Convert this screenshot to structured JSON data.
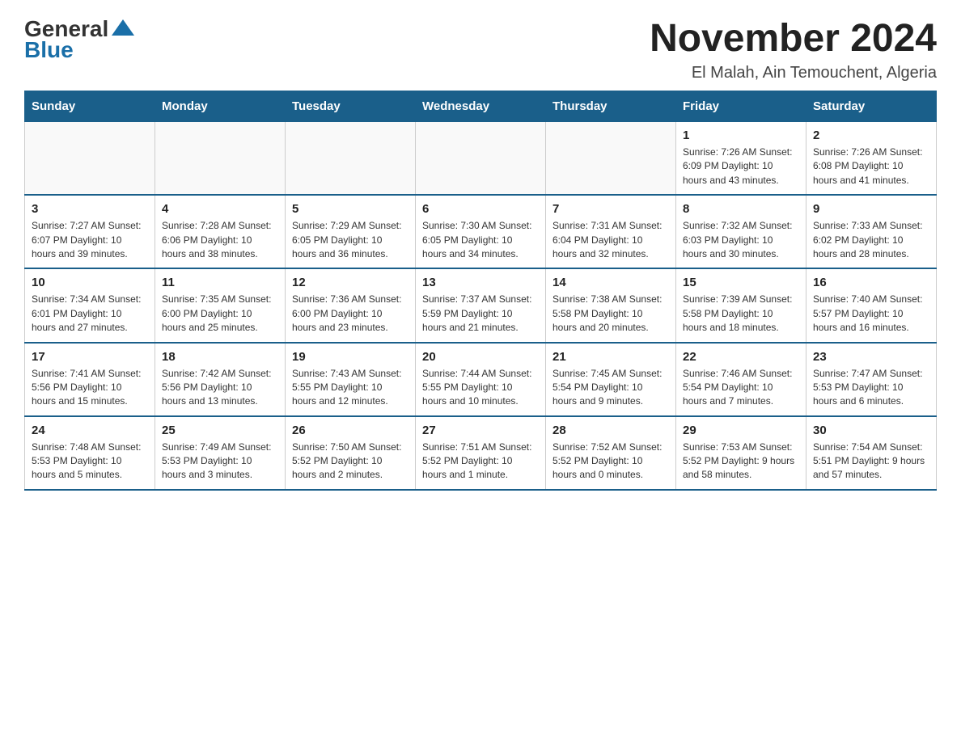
{
  "header": {
    "logo_general": "General",
    "logo_blue": "Blue",
    "title": "November 2024",
    "location": "El Malah, Ain Temouchent, Algeria"
  },
  "days_of_week": [
    "Sunday",
    "Monday",
    "Tuesday",
    "Wednesday",
    "Thursday",
    "Friday",
    "Saturday"
  ],
  "weeks": [
    [
      {
        "day": "",
        "info": ""
      },
      {
        "day": "",
        "info": ""
      },
      {
        "day": "",
        "info": ""
      },
      {
        "day": "",
        "info": ""
      },
      {
        "day": "",
        "info": ""
      },
      {
        "day": "1",
        "info": "Sunrise: 7:26 AM\nSunset: 6:09 PM\nDaylight: 10 hours and 43 minutes."
      },
      {
        "day": "2",
        "info": "Sunrise: 7:26 AM\nSunset: 6:08 PM\nDaylight: 10 hours and 41 minutes."
      }
    ],
    [
      {
        "day": "3",
        "info": "Sunrise: 7:27 AM\nSunset: 6:07 PM\nDaylight: 10 hours and 39 minutes."
      },
      {
        "day": "4",
        "info": "Sunrise: 7:28 AM\nSunset: 6:06 PM\nDaylight: 10 hours and 38 minutes."
      },
      {
        "day": "5",
        "info": "Sunrise: 7:29 AM\nSunset: 6:05 PM\nDaylight: 10 hours and 36 minutes."
      },
      {
        "day": "6",
        "info": "Sunrise: 7:30 AM\nSunset: 6:05 PM\nDaylight: 10 hours and 34 minutes."
      },
      {
        "day": "7",
        "info": "Sunrise: 7:31 AM\nSunset: 6:04 PM\nDaylight: 10 hours and 32 minutes."
      },
      {
        "day": "8",
        "info": "Sunrise: 7:32 AM\nSunset: 6:03 PM\nDaylight: 10 hours and 30 minutes."
      },
      {
        "day": "9",
        "info": "Sunrise: 7:33 AM\nSunset: 6:02 PM\nDaylight: 10 hours and 28 minutes."
      }
    ],
    [
      {
        "day": "10",
        "info": "Sunrise: 7:34 AM\nSunset: 6:01 PM\nDaylight: 10 hours and 27 minutes."
      },
      {
        "day": "11",
        "info": "Sunrise: 7:35 AM\nSunset: 6:00 PM\nDaylight: 10 hours and 25 minutes."
      },
      {
        "day": "12",
        "info": "Sunrise: 7:36 AM\nSunset: 6:00 PM\nDaylight: 10 hours and 23 minutes."
      },
      {
        "day": "13",
        "info": "Sunrise: 7:37 AM\nSunset: 5:59 PM\nDaylight: 10 hours and 21 minutes."
      },
      {
        "day": "14",
        "info": "Sunrise: 7:38 AM\nSunset: 5:58 PM\nDaylight: 10 hours and 20 minutes."
      },
      {
        "day": "15",
        "info": "Sunrise: 7:39 AM\nSunset: 5:58 PM\nDaylight: 10 hours and 18 minutes."
      },
      {
        "day": "16",
        "info": "Sunrise: 7:40 AM\nSunset: 5:57 PM\nDaylight: 10 hours and 16 minutes."
      }
    ],
    [
      {
        "day": "17",
        "info": "Sunrise: 7:41 AM\nSunset: 5:56 PM\nDaylight: 10 hours and 15 minutes."
      },
      {
        "day": "18",
        "info": "Sunrise: 7:42 AM\nSunset: 5:56 PM\nDaylight: 10 hours and 13 minutes."
      },
      {
        "day": "19",
        "info": "Sunrise: 7:43 AM\nSunset: 5:55 PM\nDaylight: 10 hours and 12 minutes."
      },
      {
        "day": "20",
        "info": "Sunrise: 7:44 AM\nSunset: 5:55 PM\nDaylight: 10 hours and 10 minutes."
      },
      {
        "day": "21",
        "info": "Sunrise: 7:45 AM\nSunset: 5:54 PM\nDaylight: 10 hours and 9 minutes."
      },
      {
        "day": "22",
        "info": "Sunrise: 7:46 AM\nSunset: 5:54 PM\nDaylight: 10 hours and 7 minutes."
      },
      {
        "day": "23",
        "info": "Sunrise: 7:47 AM\nSunset: 5:53 PM\nDaylight: 10 hours and 6 minutes."
      }
    ],
    [
      {
        "day": "24",
        "info": "Sunrise: 7:48 AM\nSunset: 5:53 PM\nDaylight: 10 hours and 5 minutes."
      },
      {
        "day": "25",
        "info": "Sunrise: 7:49 AM\nSunset: 5:53 PM\nDaylight: 10 hours and 3 minutes."
      },
      {
        "day": "26",
        "info": "Sunrise: 7:50 AM\nSunset: 5:52 PM\nDaylight: 10 hours and 2 minutes."
      },
      {
        "day": "27",
        "info": "Sunrise: 7:51 AM\nSunset: 5:52 PM\nDaylight: 10 hours and 1 minute."
      },
      {
        "day": "28",
        "info": "Sunrise: 7:52 AM\nSunset: 5:52 PM\nDaylight: 10 hours and 0 minutes."
      },
      {
        "day": "29",
        "info": "Sunrise: 7:53 AM\nSunset: 5:52 PM\nDaylight: 9 hours and 58 minutes."
      },
      {
        "day": "30",
        "info": "Sunrise: 7:54 AM\nSunset: 5:51 PM\nDaylight: 9 hours and 57 minutes."
      }
    ]
  ]
}
